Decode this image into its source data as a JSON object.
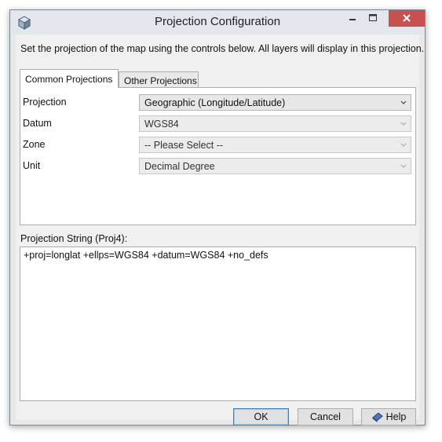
{
  "window": {
    "title": "Projection Configuration"
  },
  "description": "Set the projection of the map using the controls below. All layers will display in this projection.",
  "tabs": [
    {
      "label": "Common Projections",
      "active": true
    },
    {
      "label": "Other Projections",
      "active": false
    }
  ],
  "fields": [
    {
      "label": "Projection",
      "value": "Geographic (Longitude/Latitude)",
      "enabled": true
    },
    {
      "label": "Datum",
      "value": "WGS84",
      "enabled": false
    },
    {
      "label": "Zone",
      "value": "-- Please Select --",
      "enabled": false
    },
    {
      "label": "Unit",
      "value": "Decimal Degree",
      "enabled": false
    }
  ],
  "projection_string": {
    "label": "Projection String (Proj4):",
    "value": "+proj=longlat +ellps=WGS84 +datum=WGS84 +no_defs"
  },
  "buttons": {
    "ok": "OK",
    "cancel": "Cancel",
    "help": "Help"
  },
  "colors": {
    "close_button": "#c75050",
    "default_button_border": "#3c7fb1"
  }
}
